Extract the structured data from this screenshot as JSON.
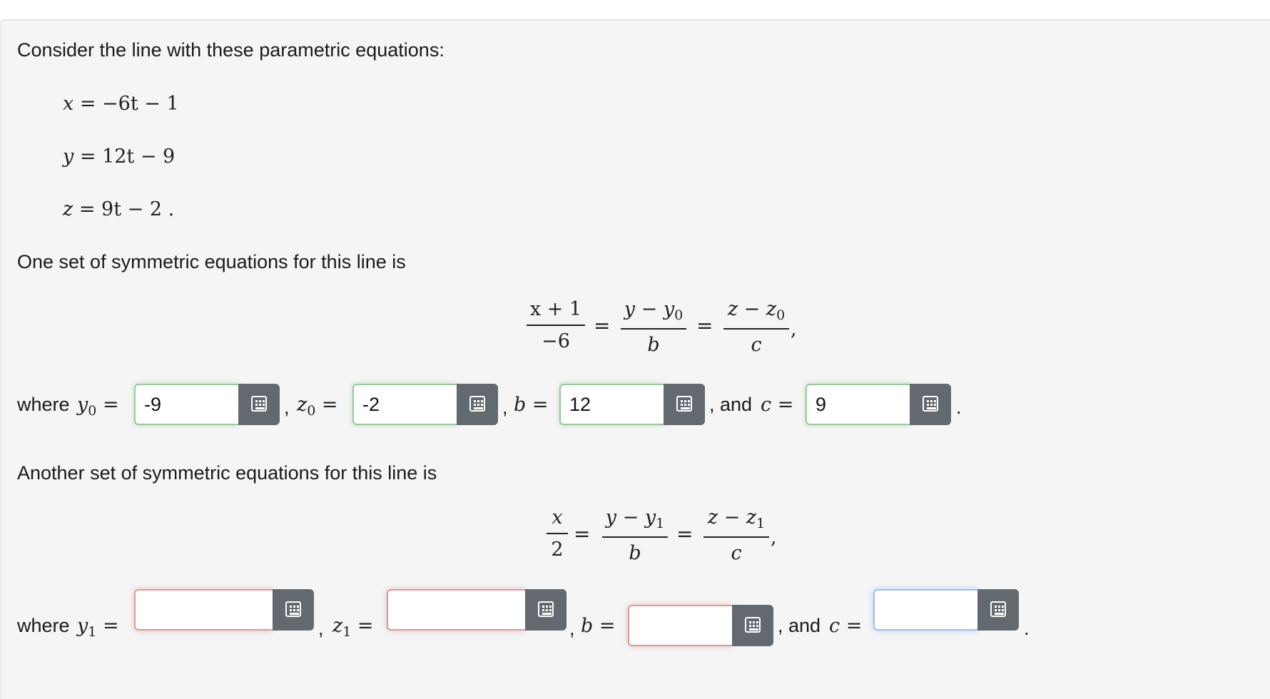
{
  "intro": "Consider the line with these parametric equations:",
  "param": {
    "x": {
      "lhs": "x",
      "rhs": "= −6t − 1"
    },
    "y": {
      "lhs": "y",
      "rhs": "= 12t − 9"
    },
    "z": {
      "lhs": "z",
      "rhs": "= 9t − 2 ."
    }
  },
  "set1": {
    "heading": "One set of symmetric equations for this line is",
    "frac1": {
      "num": "x + 1",
      "den": "−6"
    },
    "frac2": {
      "num": "y − y",
      "num_sub": "0",
      "den": "b"
    },
    "frac3": {
      "num": "z − z",
      "num_sub": "0",
      "den": "c"
    },
    "eq": "=",
    "trail": ",",
    "where_label": "where",
    "y_var": "y",
    "y_sub": "0",
    "z_var": "z",
    "z_sub": "0",
    "b_var": "b",
    "and_label": ", and",
    "c_var": "c",
    "answers": {
      "y0": "-9",
      "z0": "-2",
      "b": "12",
      "c": "9"
    }
  },
  "set2": {
    "heading": "Another set of symmetric equations for this line is",
    "frac1": {
      "num": "x",
      "den": "2"
    },
    "frac2": {
      "num": "y − y",
      "num_sub": "1",
      "den": "b"
    },
    "frac3": {
      "num": "z − z",
      "num_sub": "1",
      "den": "c"
    },
    "eq": "=",
    "trail": ",",
    "where_label": "where",
    "y_var": "y",
    "y_sub": "1",
    "z_var": "z",
    "z_sub": "1",
    "b_var": "b",
    "and_label": ", and",
    "c_var": "c",
    "answers": {
      "y1": "",
      "z1": "",
      "b": "",
      "c": ""
    }
  },
  "comma": ",",
  "period": ".",
  "keyboard_icon": "keyboard-icon",
  "colors": {
    "correct": "#9cc79c",
    "incorrect": "#d69b9b",
    "focused": "#9ec0ea",
    "button": "#626a70"
  }
}
